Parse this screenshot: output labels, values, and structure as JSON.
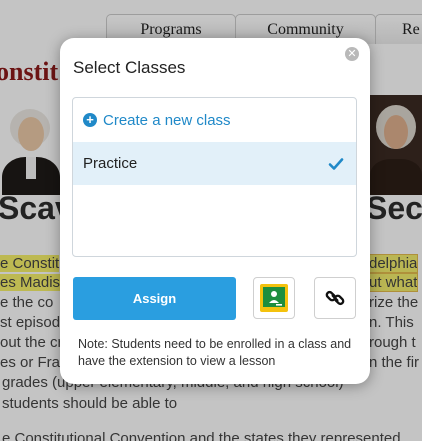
{
  "background": {
    "nav_tabs": [
      "Programs",
      "Community",
      "Re"
    ],
    "heading": "onstit",
    "big_left": "Scav",
    "big_right": "Sec",
    "lines": [
      {
        "left": "e Constit",
        "right": "delphia"
      },
      {
        "left": "es Madis",
        "right": "ut what"
      },
      {
        "left": "e the co",
        "right": "rize the"
      },
      {
        "left": "st episod",
        "right": "n. This"
      },
      {
        "left": "out the cr",
        "right": "rough t"
      },
      {
        "left": "es or Fra",
        "right": "n the fir"
      },
      {
        "full": "grades (upper elementary, middle, and high school)"
      },
      {
        "full": "students should be able to"
      },
      {
        "full": "e Constitutional Convention and the states they represented"
      }
    ]
  },
  "modal": {
    "title": "Select Classes",
    "create_label": "Create a new class",
    "classes": [
      {
        "label": "Practice",
        "selected": true
      }
    ],
    "assign_label": "Assign",
    "note": "Note: Students need to be enrolled in a class and have the extension to view a lesson"
  },
  "colors": {
    "accent": "#2a9ee0",
    "link": "#2089c8",
    "selected_row": "#e2f0f9",
    "classroom_green": "#1e8e3e",
    "classroom_yellow": "#f4c20d"
  },
  "icons": {
    "close": "close-icon",
    "create": "plus-circle-icon",
    "selected": "checkmark-icon",
    "classroom": "google-classroom-icon",
    "link": "link-icon"
  }
}
